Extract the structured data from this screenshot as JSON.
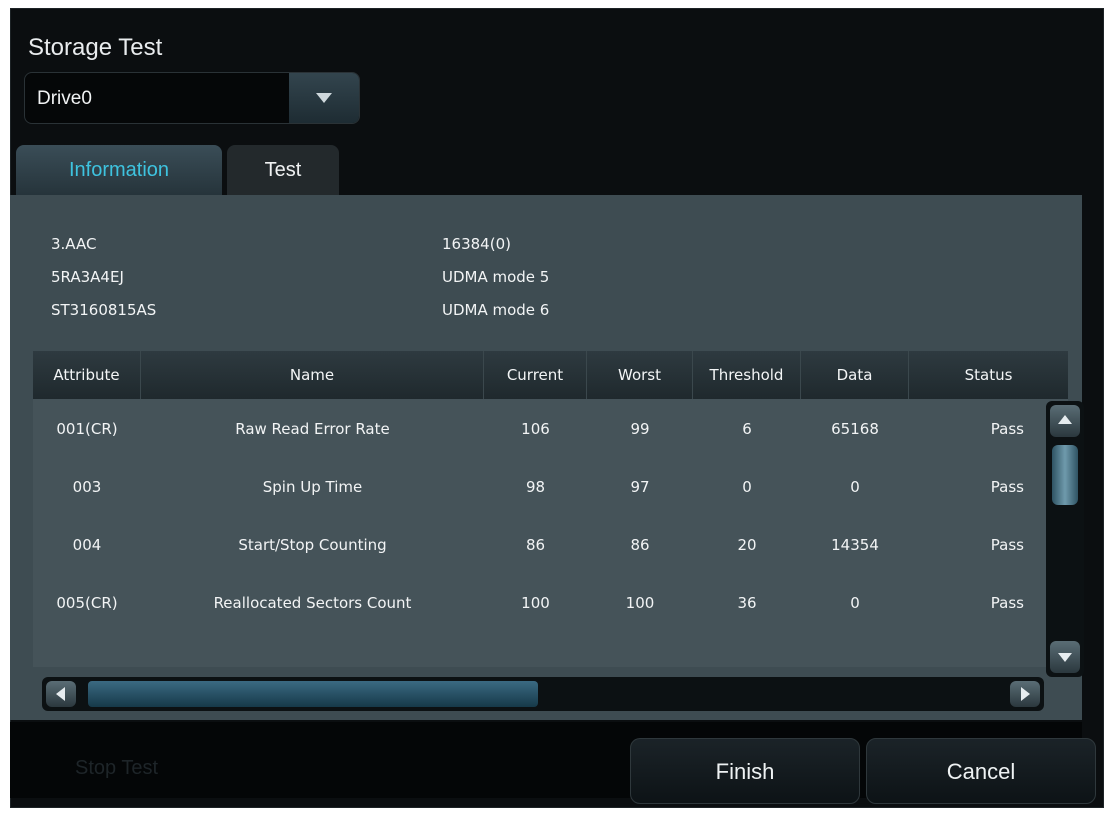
{
  "window": {
    "title": "Storage Test"
  },
  "drive_selector": {
    "selected": "Drive0"
  },
  "tabs": [
    {
      "label": "Information",
      "active": true
    },
    {
      "label": "Test",
      "active": false
    }
  ],
  "info": {
    "left": [
      "3.AAC",
      "5RA3A4EJ",
      "ST3160815AS"
    ],
    "right": [
      "16384(0)",
      "UDMA mode 5",
      "UDMA mode 6"
    ]
  },
  "table": {
    "headers": [
      "Attribute",
      "Name",
      "Current",
      "Worst",
      "Threshold",
      "Data",
      "Status"
    ],
    "rows": [
      [
        "001(CR)",
        "Raw Read Error Rate",
        "106",
        "99",
        "6",
        "65168",
        "Pass"
      ],
      [
        "003",
        "Spin Up Time",
        "98",
        "97",
        "0",
        "0",
        "Pass"
      ],
      [
        "004",
        "Start/Stop Counting",
        "86",
        "86",
        "20",
        "14354",
        "Pass"
      ],
      [
        "005(CR)",
        "Reallocated Sectors Count",
        "100",
        "100",
        "36",
        "0",
        "Pass"
      ]
    ]
  },
  "footer": {
    "ghost_label": "Stop Test",
    "finish": "Finish",
    "cancel": "Cancel"
  }
}
